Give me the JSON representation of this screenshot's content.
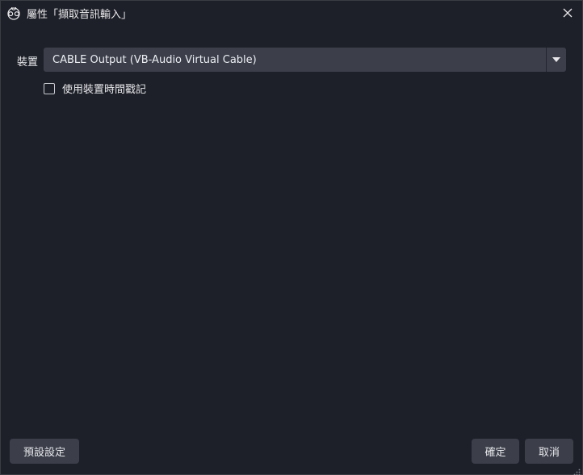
{
  "window": {
    "title": "屬性「擷取音訊輸入」",
    "app_icon": "obs-logo-icon",
    "close_icon": "close-icon"
  },
  "form": {
    "device_label": "裝置",
    "device_value": "CABLE Output (VB-Audio Virtual Cable)",
    "device_arrow_icon": "caret-down-icon",
    "timestamp_checkbox_label": "使用裝置時間戳記",
    "timestamp_checked": false
  },
  "buttons": {
    "defaults": "預設設定",
    "ok": "確定",
    "cancel": "取消"
  },
  "colors": {
    "background": "#1e2029",
    "control": "#3c3e4a",
    "text": "#e6e7ea"
  }
}
